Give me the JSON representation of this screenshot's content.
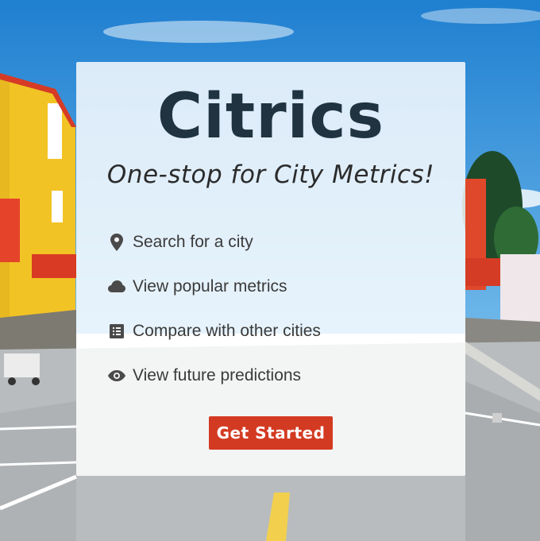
{
  "hero": {
    "title": "Citrics",
    "tagline": "One-stop for City Metrics!"
  },
  "features": [
    {
      "icon": "map-marker-icon",
      "label": "Search for a city"
    },
    {
      "icon": "cloud-icon",
      "label": "View popular metrics"
    },
    {
      "icon": "list-icon",
      "label": "Compare with other cities"
    },
    {
      "icon": "eye-icon",
      "label": "View future predictions"
    }
  ],
  "cta": {
    "label": "Get Started"
  },
  "colors": {
    "title": "#1f3340",
    "button": "#d33a22",
    "icon": "#4a4a4a",
    "sky": "#2f8fd8",
    "road": "#c9ccce"
  }
}
